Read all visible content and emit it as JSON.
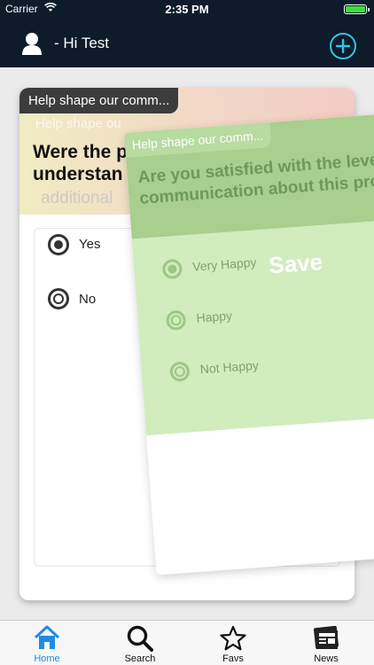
{
  "status_bar": {
    "carrier": "Carrier",
    "time": "2:35 PM",
    "battery_level": 1.0
  },
  "header": {
    "greeting": "- Hi Test",
    "add_icon": "plus-circle-icon",
    "avatar_icon": "user-icon"
  },
  "card_back": {
    "tag": "Help shape our comm...",
    "tag_ghost": "Help shape ou",
    "question": "Were the p... understan...",
    "question_line1": "Were the p",
    "question_line2": "understan",
    "ghost_text": "additional",
    "options": [
      {
        "label": "Yes",
        "selected": true
      },
      {
        "label": "No",
        "selected": false
      }
    ]
  },
  "card_front": {
    "tag": "Help shape our comm...",
    "question": "Are you satisfied with the level of communication about this project?",
    "save_label": "Save",
    "options": [
      {
        "label": "Very Happy",
        "selected": true
      },
      {
        "label": "Happy",
        "selected": false
      },
      {
        "label": "Not Happy",
        "selected": false
      }
    ]
  },
  "tab_bar": {
    "tabs": [
      {
        "label": "Home",
        "icon": "home-icon",
        "active": true
      },
      {
        "label": "Search",
        "icon": "search-icon",
        "active": false
      },
      {
        "label": "Favs",
        "icon": "star-icon",
        "active": false
      },
      {
        "label": "News",
        "icon": "newspaper-icon",
        "active": false
      }
    ]
  },
  "colors": {
    "nav_bg": "#0d1b2a",
    "accent": "#2ec7e8",
    "tab_active": "#1e8be6",
    "green_card": "#a8cf8e"
  }
}
